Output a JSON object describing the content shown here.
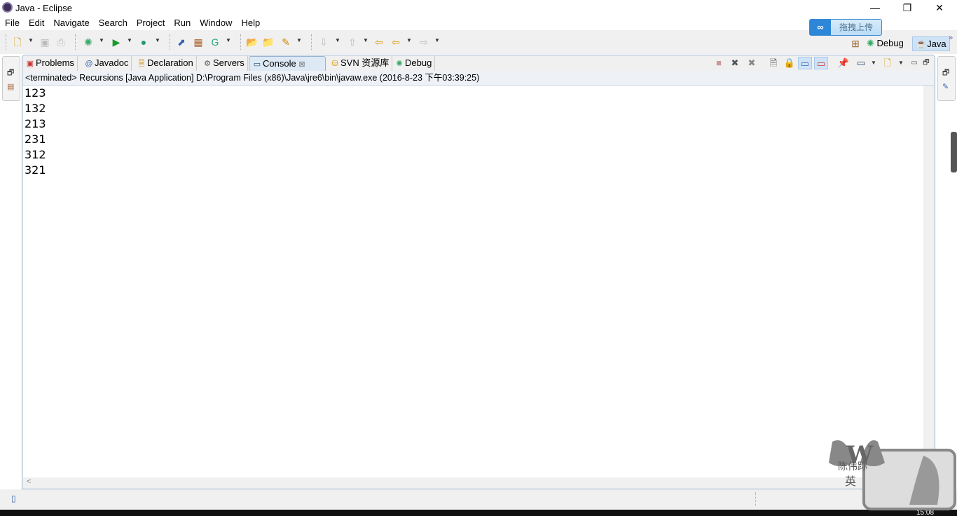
{
  "window": {
    "title": "Java - Eclipse",
    "minimize": "—",
    "restore": "❐",
    "close": "✕"
  },
  "menu": [
    "File",
    "Edit",
    "Navigate",
    "Search",
    "Project",
    "Run",
    "Window",
    "Help"
  ],
  "upload_widget": {
    "icon": "cloud-link-icon",
    "label": "拖拽上传"
  },
  "perspectives": {
    "debug": "Debug",
    "java": "Java",
    "more": "»"
  },
  "tabs": [
    {
      "label": "Problems",
      "icon": "problems-icon"
    },
    {
      "label": "Javadoc",
      "icon": "@"
    },
    {
      "label": "Declaration",
      "icon": "declaration-icon"
    },
    {
      "label": "Servers",
      "icon": "servers-icon"
    },
    {
      "label": "Console",
      "icon": "console-icon",
      "active": true,
      "close": "⊠"
    },
    {
      "label": "SVN 资源库",
      "icon": "svn-icon"
    },
    {
      "label": "Debug",
      "icon": "bug-icon"
    }
  ],
  "console": {
    "header": "<terminated> Recursions [Java Application] D:\\Program Files (x86)\\Java\\jre6\\bin\\javaw.exe (2016-8-23 下午03:39:25)",
    "lines": [
      "123",
      "132",
      "213",
      "231",
      "312",
      "321"
    ],
    "scroll_left": "<"
  },
  "watermark": {
    "text": "W 陈伟䟢 英"
  },
  "taskbar": {
    "clock": "15:08"
  }
}
